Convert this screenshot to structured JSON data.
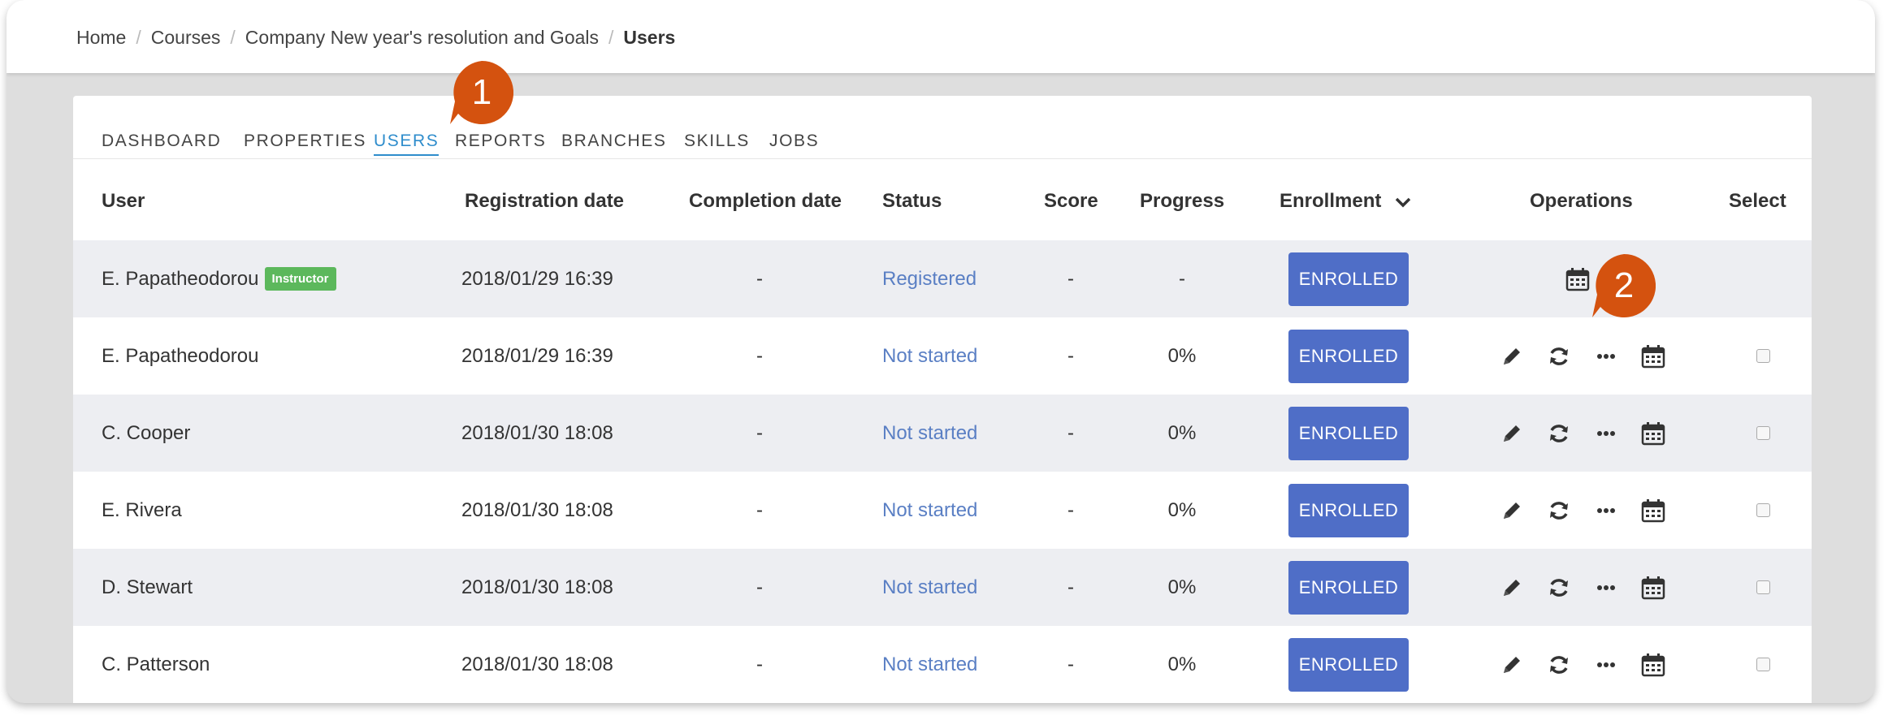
{
  "breadcrumb": {
    "items": [
      "Home",
      "Courses",
      "Company New year's resolution and Goals"
    ],
    "current": "Users"
  },
  "tabs": [
    "DASHBOARD",
    "PROPERTIES",
    "USERS",
    "REPORTS",
    "BRANCHES",
    "SKILLS",
    "JOBS"
  ],
  "active_tab": "USERS",
  "table": {
    "headers": {
      "user": "User",
      "registration_date": "Registration date",
      "completion_date": "Completion date",
      "status": "Status",
      "score": "Score",
      "progress": "Progress",
      "enrollment": "Enrollment",
      "operations": "Operations",
      "select": "Select"
    },
    "rows": [
      {
        "user": "E. Papatheodorou",
        "badge": "Instructor",
        "registration_date": "2018/01/29 16:39",
        "completion_date": "-",
        "status": "Registered",
        "score": "-",
        "progress": "-",
        "enrollment": "ENROLLED"
      },
      {
        "user": "E. Papatheodorou",
        "registration_date": "2018/01/29 16:39",
        "completion_date": "-",
        "status": "Not started",
        "score": "-",
        "progress": "0%",
        "enrollment": "ENROLLED"
      },
      {
        "user": "C. Cooper",
        "registration_date": "2018/01/30 18:08",
        "completion_date": "-",
        "status": "Not started",
        "score": "-",
        "progress": "0%",
        "enrollment": "ENROLLED"
      },
      {
        "user": "E. Rivera",
        "registration_date": "2018/01/30 18:08",
        "completion_date": "-",
        "status": "Not started",
        "score": "-",
        "progress": "0%",
        "enrollment": "ENROLLED"
      },
      {
        "user": "D. Stewart",
        "registration_date": "2018/01/30 18:08",
        "completion_date": "-",
        "status": "Not started",
        "score": "-",
        "progress": "0%",
        "enrollment": "ENROLLED"
      },
      {
        "user": "C. Patterson",
        "registration_date": "2018/01/30 18:08",
        "completion_date": "-",
        "status": "Not started",
        "score": "-",
        "progress": "0%",
        "enrollment": "ENROLLED"
      }
    ]
  },
  "icons": {
    "edit": "pencil-icon",
    "reset": "refresh-icon",
    "more": "ellipsis-icon",
    "schedule": "calendar-icon",
    "sort": "chevron-down-icon"
  },
  "callouts": [
    "1",
    "2"
  ],
  "colors": {
    "accent": "#2f8dcc",
    "enrolled_button": "#4f6ec7",
    "instructor_badge": "#5cb85c",
    "status_text": "#5a7fc4",
    "callout": "#d4520f"
  }
}
